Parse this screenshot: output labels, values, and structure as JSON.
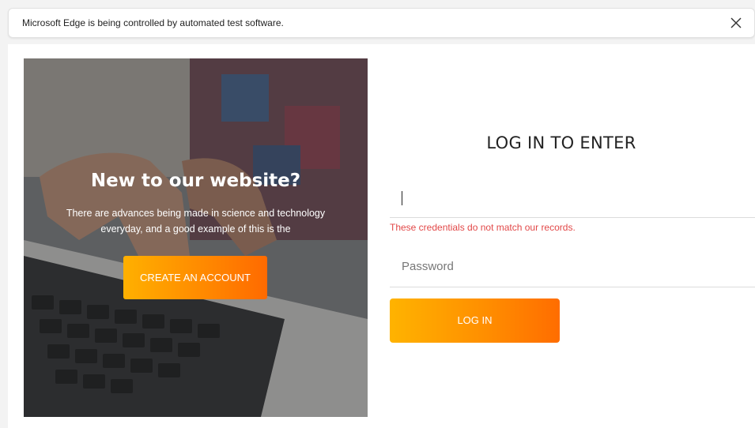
{
  "infobar": {
    "message": "Microsoft Edge is being controlled by automated test software.",
    "close_icon": "close-icon"
  },
  "hero": {
    "title": "New to our website?",
    "text": "There are advances being made in science and technology everyday, and a good example of this is the",
    "button_label": "CREATE AN ACCOUNT"
  },
  "login": {
    "title": "LOG IN TO ENTER",
    "email_value": "",
    "error": "These credentials do not match our records.",
    "password_placeholder": "Password",
    "button_label": "LOG IN"
  },
  "colors": {
    "accent_start": "#ffb000",
    "accent_end": "#ff6a00",
    "error": "#e24848"
  }
}
